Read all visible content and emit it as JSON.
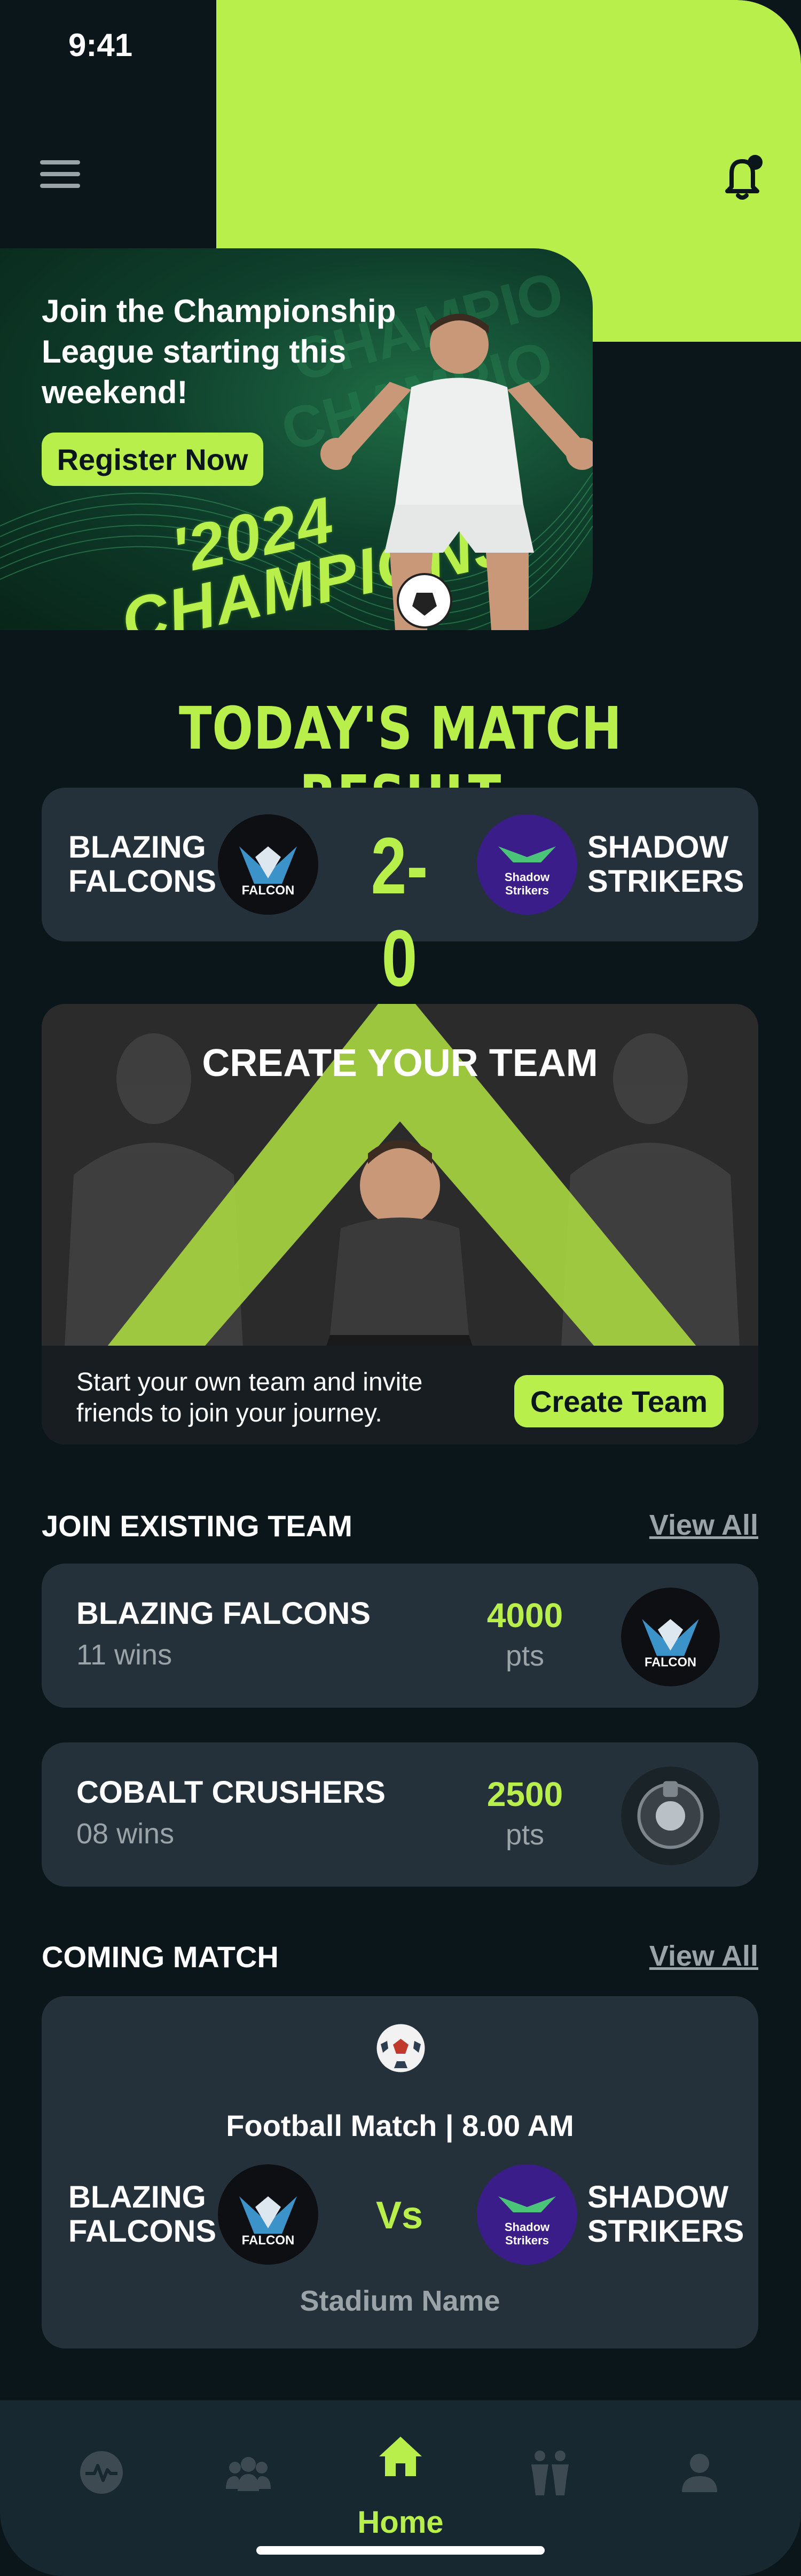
{
  "status_bar": {
    "time": "9:41"
  },
  "banner": {
    "text": "Join the Championship League starting this weekend!",
    "button_label": "Register Now",
    "art_text_line1": "'2024",
    "art_text_line2": "CHAMPIONS"
  },
  "match_result": {
    "title": "TODAY'S MATCH RESULT",
    "home_team_line1": "BLAZING",
    "home_team_line2": "FALCONS",
    "score": "2-0",
    "away_team_line1": "SHADOW",
    "away_team_line2": "STRIKERS"
  },
  "logos": {
    "falcons_text": "FALCON",
    "shadow_text_line1": "Shadow",
    "shadow_text_line2": "Strikers"
  },
  "create_team": {
    "title": "CREATE YOUR TEAM",
    "description": "Start your own team and invite friends to join your journey.",
    "button_label": "Create Team"
  },
  "join_team": {
    "title": "JOIN EXISTING TEAM",
    "view_all": "View All",
    "teams": [
      {
        "name": "BLAZING FALCONS",
        "wins": "11 wins",
        "points": "4000",
        "points_label": "pts"
      },
      {
        "name": "COBALT CRUSHERS",
        "wins": "08 wins",
        "points": "2500",
        "points_label": "pts"
      }
    ]
  },
  "coming_match": {
    "title": "COMING MATCH",
    "view_all": "View All",
    "info": "Football Match | 8.00 AM",
    "home_team_line1": "BLAZING",
    "home_team_line2": "FALCONS",
    "vs": "Vs",
    "away_team_line1": "SHADOW",
    "away_team_line2": "STRIKERS",
    "stadium": "Stadium Name"
  },
  "nav": {
    "home_label": "Home"
  },
  "colors": {
    "accent": "#b8ef4b",
    "background": "#0b161b",
    "card": "#25313a",
    "muted": "#9aa3a8"
  }
}
